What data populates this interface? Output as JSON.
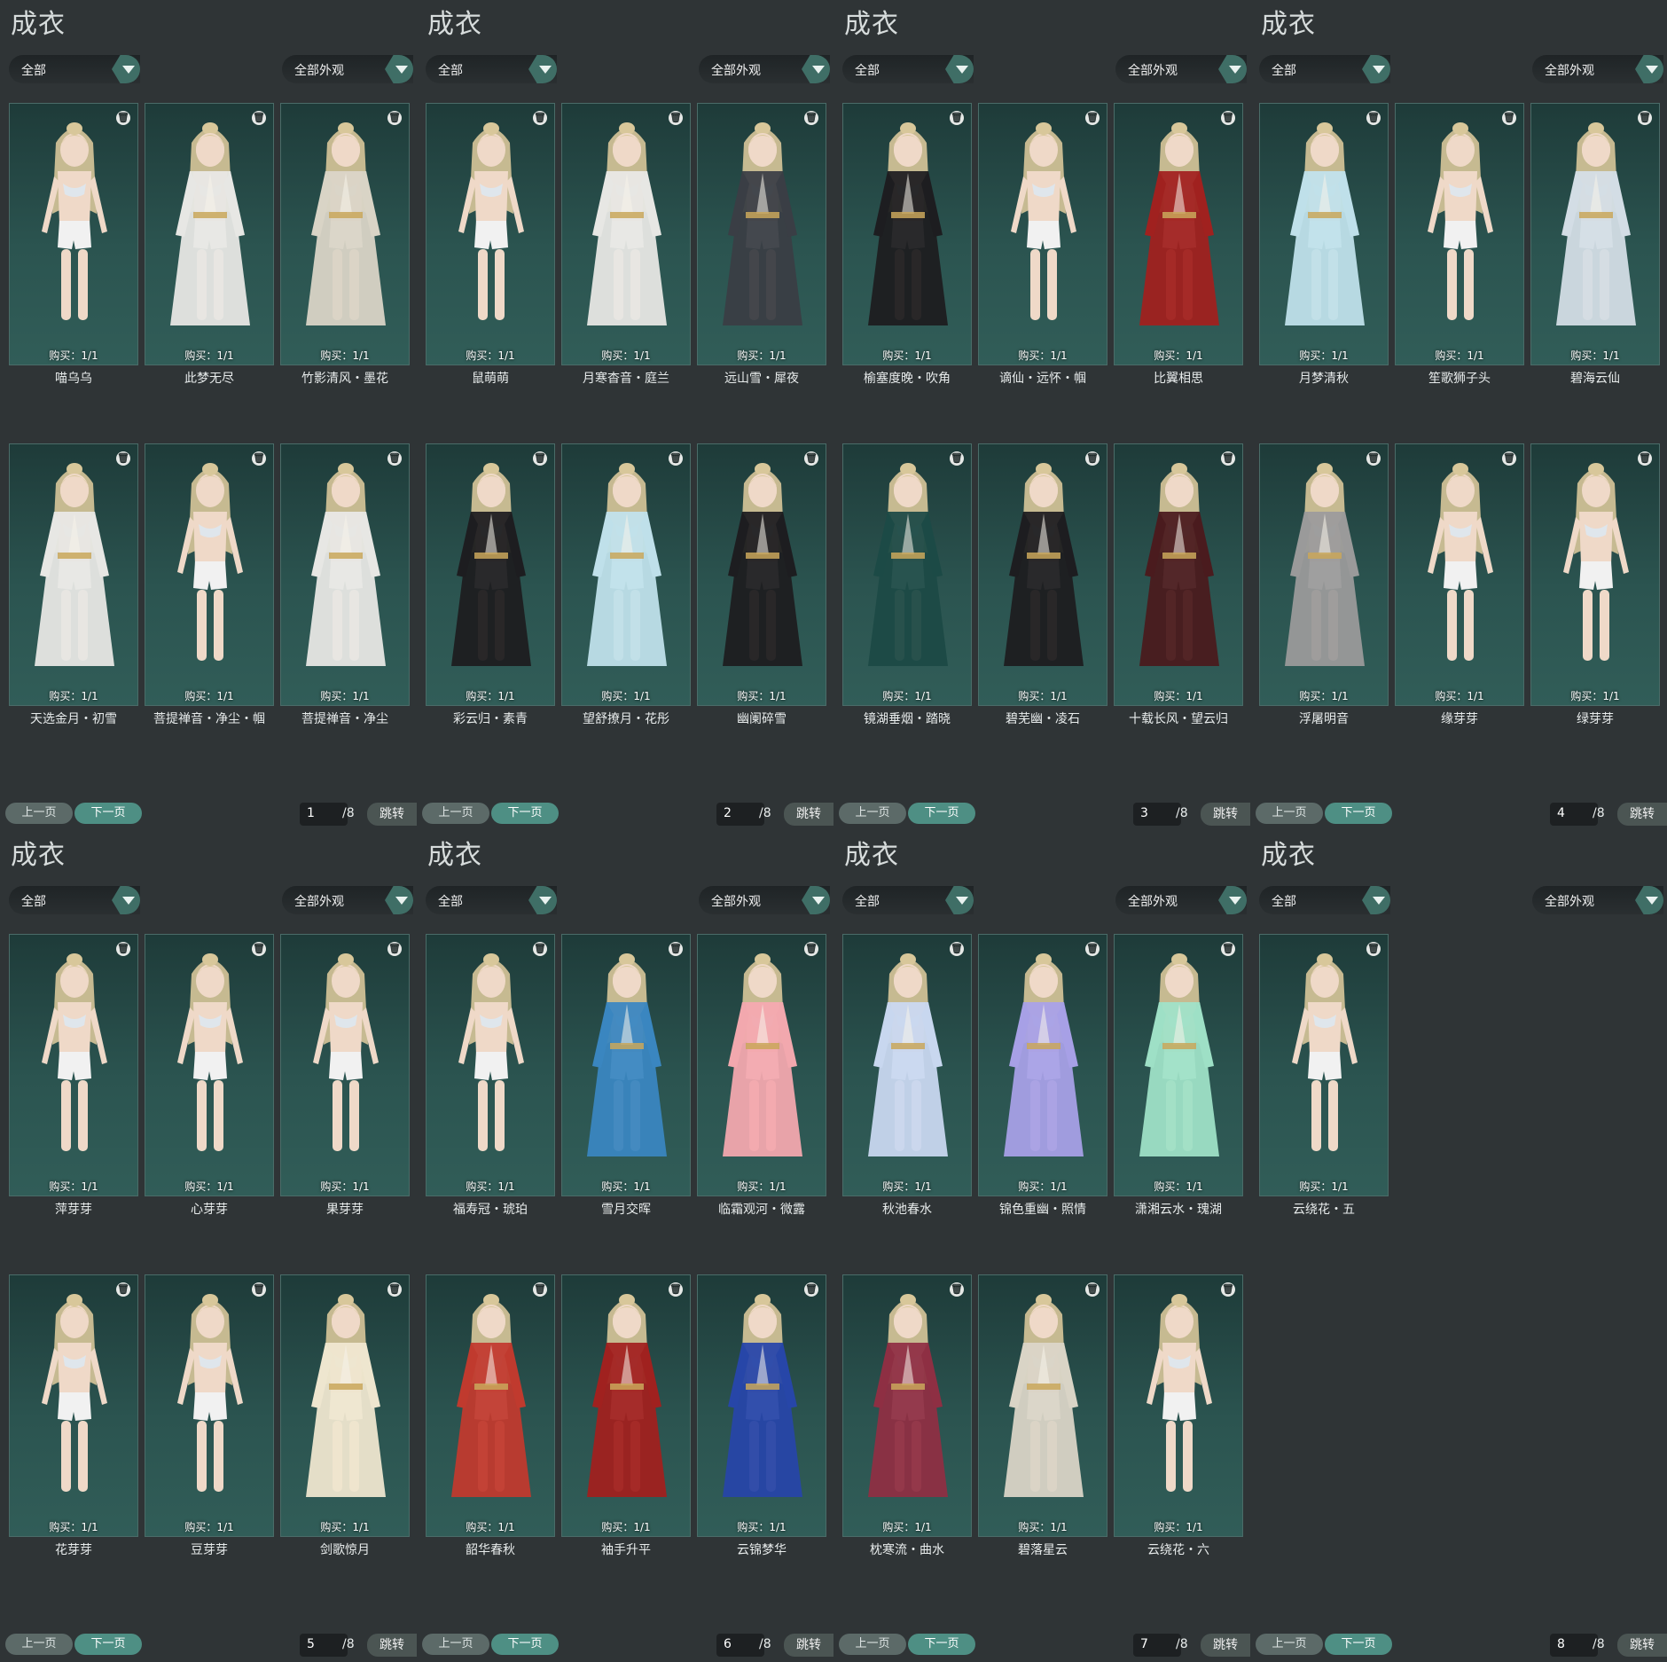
{
  "panels": [
    {
      "title": "成衣",
      "filter": "全部",
      "appearance_filter": "全部外观",
      "prev": "上一页",
      "next": "下一页",
      "page": "1",
      "total": "/8",
      "jump": "跳转",
      "items": [
        {
          "name": "喵乌乌",
          "buy": "购买：1/1",
          "outfit": "none"
        },
        {
          "name": "此梦无尽",
          "buy": "购买：1/1",
          "outfit": "white"
        },
        {
          "name": "竹影清风・墨花",
          "buy": "购买：1/1",
          "outfit": "dark-white"
        },
        {
          "name": "天选金月・初雪",
          "buy": "购买：1/1",
          "outfit": "white"
        },
        {
          "name": "菩提禅音・净尘・帼",
          "buy": "购买：1/1",
          "outfit": "none"
        },
        {
          "name": "菩提禅音・净尘",
          "buy": "购买：1/1",
          "outfit": "white"
        }
      ]
    },
    {
      "title": "成衣",
      "filter": "全部",
      "appearance_filter": "全部外观",
      "prev": "上一页",
      "next": "下一页",
      "page": "2",
      "total": "/8",
      "jump": "跳转",
      "items": [
        {
          "name": "鼠萌萌",
          "buy": "购买：1/1",
          "outfit": "none"
        },
        {
          "name": "月寒杳音・庭兰",
          "buy": "购买：1/1",
          "outfit": "white"
        },
        {
          "name": "远山雪・犀夜",
          "buy": "购买：1/1",
          "outfit": "dark"
        },
        {
          "name": "彩云归・素青",
          "buy": "购买：1/1",
          "outfit": "black"
        },
        {
          "name": "望舒撩月・花彤",
          "buy": "购买：1/1",
          "outfit": "lightblue"
        },
        {
          "name": "幽阑碎雪",
          "buy": "购买：1/1",
          "outfit": "black"
        }
      ]
    },
    {
      "title": "成衣",
      "filter": "全部",
      "appearance_filter": "全部外观",
      "prev": "上一页",
      "next": "下一页",
      "page": "3",
      "total": "/8",
      "jump": "跳转",
      "items": [
        {
          "name": "榆塞度晚・吹角",
          "buy": "购买：1/1",
          "outfit": "black"
        },
        {
          "name": "谪仙・远怀・帼",
          "buy": "购买：1/1",
          "outfit": "none"
        },
        {
          "name": "比翼相思",
          "buy": "购买：1/1",
          "outfit": "red"
        },
        {
          "name": "镜湖垂烟・踏晓",
          "buy": "购买：1/1",
          "outfit": "teal"
        },
        {
          "name": "碧芜幽・凌石",
          "buy": "购买：1/1",
          "outfit": "black"
        },
        {
          "name": "十载长风・望云归",
          "buy": "购买：1/1",
          "outfit": "darkred"
        }
      ]
    },
    {
      "title": "成衣",
      "filter": "全部",
      "appearance_filter": "全部外观",
      "prev": "上一页",
      "next": "下一页",
      "page": "4",
      "total": "/8",
      "jump": "跳转",
      "items": [
        {
          "name": "月梦清秋",
          "buy": "购买：1/1",
          "outfit": "lightblue"
        },
        {
          "name": "笙歌狮子头",
          "buy": "购买：1/1",
          "outfit": "none"
        },
        {
          "name": "碧海云仙",
          "buy": "购买：1/1",
          "outfit": "silver"
        },
        {
          "name": "浮屠明音",
          "buy": "购买：1/1",
          "outfit": "grey"
        },
        {
          "name": "缘芽芽",
          "buy": "购买：1/1",
          "outfit": "none"
        },
        {
          "name": "绿芽芽",
          "buy": "购买：1/1",
          "outfit": "none"
        }
      ]
    },
    {
      "title": "成衣",
      "filter": "全部",
      "appearance_filter": "全部外观",
      "prev": "上一页",
      "next": "下一页",
      "page": "5",
      "total": "/8",
      "jump": "跳转",
      "items": [
        {
          "name": "萍芽芽",
          "buy": "购买：1/1",
          "outfit": "none"
        },
        {
          "name": "心芽芽",
          "buy": "购买：1/1",
          "outfit": "none"
        },
        {
          "name": "果芽芽",
          "buy": "购买：1/1",
          "outfit": "none"
        },
        {
          "name": "花芽芽",
          "buy": "购买：1/1",
          "outfit": "none"
        },
        {
          "name": "豆芽芽",
          "buy": "购买：1/1",
          "outfit": "none"
        },
        {
          "name": "剑歌惊月",
          "buy": "购买：1/1",
          "outfit": "cream"
        }
      ]
    },
    {
      "title": "成衣",
      "filter": "全部",
      "appearance_filter": "全部外观",
      "prev": "上一页",
      "next": "下一页",
      "page": "6",
      "total": "/8",
      "jump": "跳转",
      "items": [
        {
          "name": "福寿冠・琥珀",
          "buy": "购买：1/1",
          "outfit": "none"
        },
        {
          "name": "雪月交晖",
          "buy": "购买：1/1",
          "outfit": "blue"
        },
        {
          "name": "临霜观河・微露",
          "buy": "购买：1/1",
          "outfit": "pink"
        },
        {
          "name": "韶华春秋",
          "buy": "购买：1/1",
          "outfit": "redwhite"
        },
        {
          "name": "袖手升平",
          "buy": "购买：1/1",
          "outfit": "red"
        },
        {
          "name": "云锦梦华",
          "buy": "购买：1/1",
          "outfit": "royal"
        }
      ]
    },
    {
      "title": "成衣",
      "filter": "全部",
      "appearance_filter": "全部外观",
      "prev": "上一页",
      "next": "下一页",
      "page": "7",
      "total": "/8",
      "jump": "跳转",
      "items": [
        {
          "name": "秋池春水",
          "buy": "购买：1/1",
          "outfit": "whiteblue"
        },
        {
          "name": "锦色重幽・照情",
          "buy": "购买：1/1",
          "outfit": "lavender"
        },
        {
          "name": "潇湘云水・瑰湖",
          "buy": "购买：1/1",
          "outfit": "mint"
        },
        {
          "name": "枕寒流・曲水",
          "buy": "购买：1/1",
          "outfit": "crimson"
        },
        {
          "name": "碧落星云",
          "buy": "购买：1/1",
          "outfit": "dark-white"
        },
        {
          "name": "云绕花・六",
          "buy": "购买：1/1",
          "outfit": "none"
        }
      ]
    },
    {
      "title": "成衣",
      "filter": "全部",
      "appearance_filter": "全部外观",
      "prev": "上一页",
      "next": "下一页",
      "page": "8",
      "total": "/8",
      "jump": "跳转",
      "items": [
        {
          "name": "云绕花・五",
          "buy": "购买：1/1",
          "outfit": "none"
        }
      ]
    }
  ],
  "icons": {
    "delete": "trash-icon",
    "dropdown": "chevron-down-icon"
  },
  "colors": {
    "background": "#2f3436",
    "card_top": "#1e3b39",
    "card_bottom": "#315d58",
    "accent": "#4e8f84",
    "dropdown_arrow": "#3f6e66",
    "outfits": {
      "none": "#ede8e2",
      "white": "#e7e7e4",
      "dark-white": "#d9d4c6",
      "dark": "#3a3e45",
      "black": "#1d1d20",
      "lightblue": "#bfe0ea",
      "red": "#a0211f",
      "darkred": "#4a1b1e",
      "teal": "#1c4a46",
      "silver": "#d3dde5",
      "grey": "#9a9a9a",
      "cream": "#eee6cf",
      "blue": "#3a86c0",
      "pink": "#f2a8ae",
      "redwhite": "#c03a2e",
      "royal": "#2746a8",
      "whiteblue": "#c8d7ef",
      "lavender": "#a7a0e6",
      "mint": "#9ee0c6",
      "crimson": "#8e2f43"
    }
  }
}
